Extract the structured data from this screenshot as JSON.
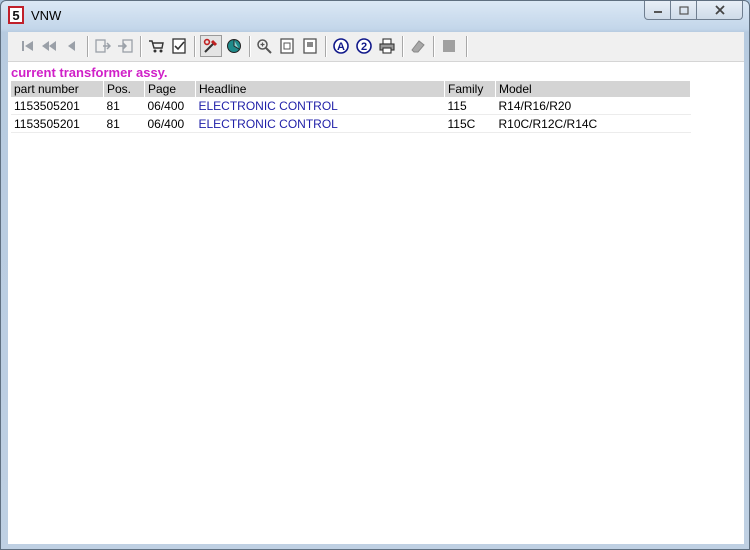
{
  "window": {
    "title": "VNW"
  },
  "toolbar": {
    "buttons": [
      {
        "icon": "first-record-icon"
      },
      {
        "icon": "previous-page-icon"
      },
      {
        "icon": "previous-record-icon"
      },
      {
        "icon": "export-icon"
      },
      {
        "icon": "import-icon"
      },
      {
        "icon": "cart-icon"
      },
      {
        "icon": "checklist-icon"
      },
      {
        "icon": "tools-icon"
      },
      {
        "icon": "globe-icon"
      },
      {
        "icon": "zoom-icon"
      },
      {
        "icon": "page-icon"
      },
      {
        "icon": "page-alt-icon"
      },
      {
        "icon": "letter-a-icon"
      },
      {
        "icon": "number-2-icon"
      },
      {
        "icon": "print-icon"
      },
      {
        "icon": "eraser-icon"
      },
      {
        "icon": "stop-icon"
      }
    ]
  },
  "content": {
    "heading": "current transformer assy.",
    "columns": [
      "part number",
      "Pos.",
      "Page",
      "Headline",
      "Family",
      "Model"
    ],
    "rows": [
      [
        "1153505201",
        "81",
        "06/400",
        "ELECTRONIC CONTROL",
        "115",
        "R14/R16/R20"
      ],
      [
        "1153505201",
        "81",
        "06/400",
        "ELECTRONIC CONTROL",
        "115C",
        "R10C/R12C/R14C"
      ]
    ]
  },
  "colors": {
    "heading": "#d020c8",
    "link": "#1f1fa8",
    "header_bg": "#d4d4d4"
  }
}
